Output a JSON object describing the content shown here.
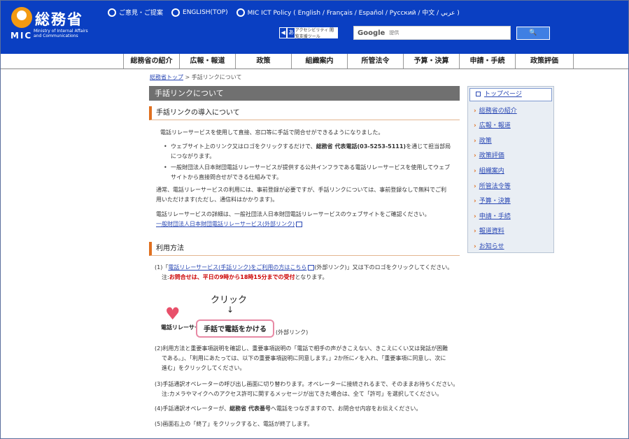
{
  "header": {
    "logo_jp": "総務省",
    "logo_mic": "MIC",
    "logo_sub": "Ministry of Internal Affairs and Communications",
    "links": [
      {
        "label": "ご意見・ご提案"
      },
      {
        "label": "ENGLISH(TOP)"
      },
      {
        "label": "MIC ICT Policy ( English / Français / Español / Русский / 中文 / عربي )"
      }
    ],
    "accessibility_label": "アクセシビリティ 閲覧支援ツール",
    "search_brand": "Google",
    "search_placeholder": "提供",
    "search_button": "🔍"
  },
  "gnav": [
    "総務省の紹介",
    "広報・報道",
    "政策",
    "組織案内",
    "所管法令",
    "予算・決算",
    "申請・手続",
    "政策評価"
  ],
  "breadcrumb": {
    "home": "総務省トップ",
    "sep": ">",
    "current": "手話リンクについて"
  },
  "page_title": "手話リンクについて",
  "section1": {
    "heading": "手話リンクの導入について",
    "intro": "電話リレーサービスを使用して直接、窓口等に手話で問合せができるようになりました。",
    "bullet1_a": "ウェブサイト上のリンク又はロゴをクリックするだけで、",
    "bullet1_b": "総務省 代表電話(03-5253-5111)",
    "bullet1_c": "を通じて担当部局",
    "bullet1_d": "につながります。",
    "bullet2_a": "一般財団法人日本財団電話リレーサービスが提供する公共インフラである電話リレーサービスを使用してウェブ",
    "bullet2_b": "サイトから直接問合せができる仕組みです。",
    "para2_a": "通常、電話リレーサービスの利用には、事前登録が必要ですが、手話リンクについては、事前登録なしで無料でご利",
    "para2_b": "用いただけます(ただし、通信料はかかります)。",
    "para3": "電話リレーサービスの詳細は、一般社団法人日本財団電話リレーサービスのウェブサイトをご確認ください。",
    "para3_link": "一般財団法人日本財団電話リレーサービス(外部リンク)"
  },
  "section2": {
    "heading": "利用方法",
    "step1_a": "(1)「",
    "step1_link": "電話リレーサービス(手話リンク)をご利用の方はこちら",
    "step1_b": "(外部リンク)」又は下のロゴをクリックしてください。",
    "note_a": "注:",
    "note_red": "お問合せは、平日の9時から18時15分までの受付",
    "note_b": "となります。",
    "click_label": "クリック",
    "arrow": "↓",
    "relay_logo_text": "電話リレーサービス",
    "sign_button": "手話で電話をかける",
    "ext_note": "(外部リンク)",
    "step2_a": "(2)利用方法と重要事項説明を確認し、重要事項説明の「電話で相手の声がきこえない、きこえにくい又は発話が困難",
    "step2_b": "である。」、「利用にあたっては、以下の重要事項説明に同意します。」2か所に✓を入れ、「重要事項に同意し、次に",
    "step2_c": "進む」をクリックしてください。",
    "step3_a": "(3)手話通訳オペレーターの呼び出し画面に切り替わります。オペレーターに接続されるまで、そのままお待ちください。",
    "step3_b": "注:カメラやマイクへのアクセス許可に関するメッセージが出てきた場合は、全て「許可」を選択してください。",
    "step4_a": "(4)手話通訳オペレーターが、",
    "step4_b": "総務省 代表番号",
    "step4_c": "へ電話をつなぎますので、お問合せ内容をお伝えください。",
    "step5": "(5)画面右上の「終了」をクリックすると、電話が終了します。"
  },
  "side": {
    "top": "トップページ",
    "items": [
      "総務省の紹介",
      "広報・報道",
      "政策",
      "政策評価",
      "組織案内",
      "所管法令等",
      "予算・決算",
      "申請・手続",
      "報道資料",
      "お知らせ"
    ]
  }
}
